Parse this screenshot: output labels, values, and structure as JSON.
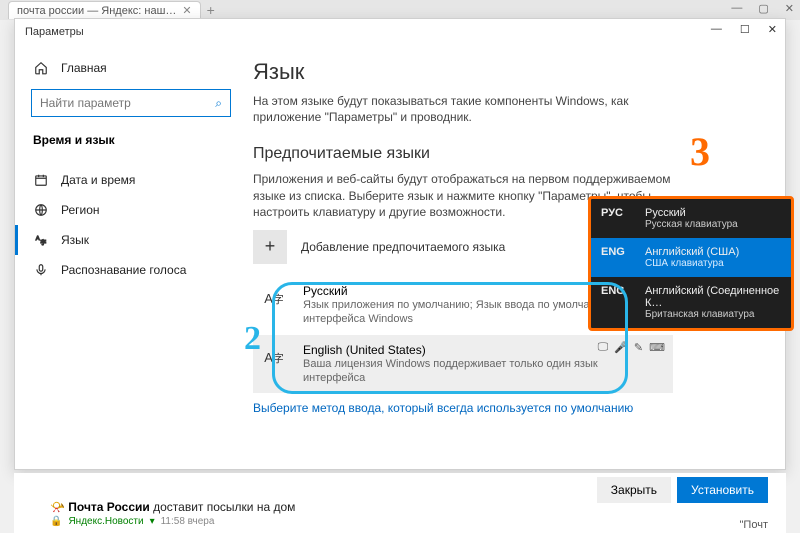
{
  "browser": {
    "tab_title": "почта россии — Яндекс: наш…",
    "window_controls": {
      "min": "—",
      "max": "▢",
      "close": "✕"
    }
  },
  "window": {
    "title": "Параметры",
    "controls": {
      "min": "—",
      "max": "☐",
      "close": "✕"
    }
  },
  "sidebar": {
    "home": "Главная",
    "search_placeholder": "Найти параметр",
    "section_heading": "Время и язык",
    "items": [
      {
        "label": "Дата и время"
      },
      {
        "label": "Регион"
      },
      {
        "label": "Язык"
      },
      {
        "label": "Распознавание голоса"
      }
    ]
  },
  "main": {
    "h1": "Язык",
    "desc": "На этом языке будут показываться такие компоненты Windows, как приложение \"Параметры\" и проводник.",
    "h2": "Предпочитаемые языки",
    "desc2": "Приложения и веб-сайты будут отображаться на первом поддерживаемом языке из списка. Выберите язык и нажмите кнопку \"Параметры\", чтобы настроить клавиатуру и другие возможности.",
    "add_label": "Добавление предпочитаемого языка",
    "languages": [
      {
        "name": "Русский",
        "sub": "Язык приложения по умолчанию; Язык ввода по умолчанию; Язык интерфейса Windows"
      },
      {
        "name": "English (United States)",
        "sub": "Ваша лицензия Windows поддерживает только один язык интерфейса"
      }
    ],
    "link": "Выберите метод ввода, который всегда используется по умолчанию"
  },
  "lang_switcher": [
    {
      "code": "РУС",
      "name": "Русский",
      "sub": "Русская клавиатура"
    },
    {
      "code": "ENG",
      "name": "Английский (США)",
      "sub": "США клавиатура"
    },
    {
      "code": "ENG",
      "name": "Английский (Соединенное К…",
      "sub": "Британская клавиатура"
    }
  ],
  "annotations": {
    "two": "2",
    "three": "3"
  },
  "bottom": {
    "close": "Закрыть",
    "install": "Установить",
    "headline_bold": "Почта России",
    "headline_rest": " доставит посылки на дом",
    "source": "Яндекс.Новости",
    "time": "11:58 вчера",
    "snippet": "\"Почт"
  }
}
